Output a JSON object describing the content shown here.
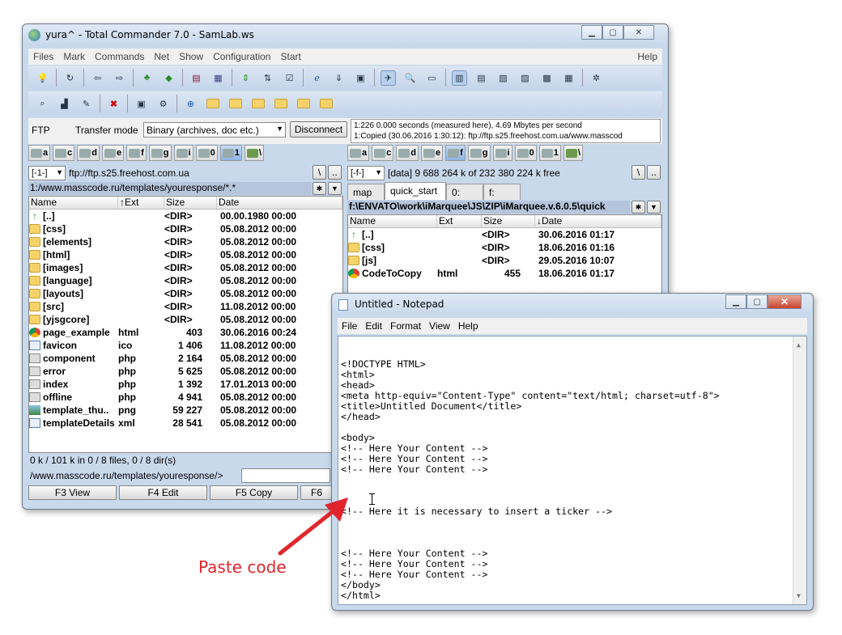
{
  "tc": {
    "title": "yura^ - Total Commander 7.0 - SamLab.ws",
    "menu": [
      "Files",
      "Mark",
      "Commands",
      "Net",
      "Show",
      "Configuration",
      "Start"
    ],
    "menu_help": "Help",
    "ftp_label": "FTP",
    "transfer_label": "Transfer mode",
    "transfer_mode": "Binary (archives, doc etc.)",
    "disconnect_label": "Disconnect",
    "log": [
      "1:226 0.000 seconds (measured here), 4.69 Mbytes per second",
      "1:Copied (30.06.2016 1:30:12): ftp://ftp.s25.freehost.com.ua/www.masscod"
    ],
    "drives": [
      "a",
      "c",
      "d",
      "e",
      "f",
      "g",
      "i",
      "0",
      "1",
      "\\"
    ],
    "left": {
      "drive_combo": "[-1-]",
      "location": "ftp://ftp.s25.freehost.com.ua",
      "path": "1:/www.masscode.ru/templates/youresponse/*.*",
      "columns": [
        "Name",
        "↑Ext",
        "Size",
        "Date"
      ],
      "files": [
        {
          "icon": "up",
          "name": "[..]",
          "ext": "",
          "size": "<DIR>",
          "date": "00.00.1980 00:00"
        },
        {
          "icon": "folder",
          "name": "[css]",
          "ext": "",
          "size": "<DIR>",
          "date": "05.08.2012 00:00"
        },
        {
          "icon": "folder",
          "name": "[elements]",
          "ext": "",
          "size": "<DIR>",
          "date": "05.08.2012 00:00"
        },
        {
          "icon": "folder",
          "name": "[html]",
          "ext": "",
          "size": "<DIR>",
          "date": "05.08.2012 00:00"
        },
        {
          "icon": "folder",
          "name": "[images]",
          "ext": "",
          "size": "<DIR>",
          "date": "05.08.2012 00:00"
        },
        {
          "icon": "folder",
          "name": "[language]",
          "ext": "",
          "size": "<DIR>",
          "date": "05.08.2012 00:00"
        },
        {
          "icon": "folder",
          "name": "[layouts]",
          "ext": "",
          "size": "<DIR>",
          "date": "05.08.2012 00:00"
        },
        {
          "icon": "folder",
          "name": "[src]",
          "ext": "",
          "size": "<DIR>",
          "date": "11.08.2012 00:00"
        },
        {
          "icon": "folder",
          "name": "[yjsgcore]",
          "ext": "",
          "size": "<DIR>",
          "date": "05.08.2012 00:00"
        },
        {
          "icon": "chrome",
          "name": "page_example",
          "ext": "html",
          "size": "403",
          "date": "30.06.2016 00:24"
        },
        {
          "icon": "doc",
          "name": "favicon",
          "ext": "ico",
          "size": "1 406",
          "date": "11.08.2012 00:00"
        },
        {
          "icon": "dll",
          "name": "component",
          "ext": "php",
          "size": "2 164",
          "date": "05.08.2012 00:00"
        },
        {
          "icon": "dll",
          "name": "error",
          "ext": "php",
          "size": "5 625",
          "date": "05.08.2012 00:00"
        },
        {
          "icon": "dll",
          "name": "index",
          "ext": "php",
          "size": "1 392",
          "date": "17.01.2013 00:00"
        },
        {
          "icon": "dll",
          "name": "offline",
          "ext": "php",
          "size": "4 941",
          "date": "05.08.2012 00:00"
        },
        {
          "icon": "img",
          "name": "template_thu..",
          "ext": "png",
          "size": "59 227",
          "date": "05.08.2012 00:00"
        },
        {
          "icon": "doc",
          "name": "templateDetails",
          "ext": "xml",
          "size": "28 541",
          "date": "05.08.2012 00:00"
        }
      ],
      "status": "0 k / 101 k in 0 / 8 files, 0 / 8 dir(s)",
      "cmd_path": "/www.masscode.ru/templates/youresponse/>"
    },
    "right": {
      "drive_combo": "[-f-]",
      "location": "[data]  9 688 264 k of 232 380 224 k free",
      "tabs": [
        "map",
        "quick_start",
        "0:",
        "f:"
      ],
      "path": "f:\\ENVATO\\work\\iMarquee\\JS\\ZIP\\iMarquee.v.6.0.5\\quick",
      "columns": [
        "Name",
        "Ext",
        "Size",
        "↓Date"
      ],
      "files": [
        {
          "icon": "up",
          "name": "[..]",
          "ext": "",
          "size": "<DIR>",
          "date": "30.06.2016 01:17"
        },
        {
          "icon": "folder",
          "name": "[css]",
          "ext": "",
          "size": "<DIR>",
          "date": "18.06.2016 01:16"
        },
        {
          "icon": "folder",
          "name": "[js]",
          "ext": "",
          "size": "<DIR>",
          "date": "29.05.2016 10:07"
        },
        {
          "icon": "chrome",
          "name": "CodeToCopy",
          "ext": "html",
          "size": "455",
          "date": "18.06.2016 01:17"
        }
      ]
    },
    "fkeys": [
      "F3 View",
      "F4 Edit",
      "F5 Copy",
      "F6"
    ]
  },
  "notepad": {
    "title": "Untitled - Notepad",
    "menu": [
      "File",
      "Edit",
      "Format",
      "View",
      "Help"
    ],
    "content": "<!DOCTYPE HTML>\n<html>\n<head>\n<meta http-equiv=\"Content-Type\" content=\"text/html; charset=utf-8\">\n<title>Untitled Document</title>\n</head>\n\n<body>\n<!-- Here Your Content -->\n<!-- Here Your Content -->\n<!-- Here Your Content -->\n\n\n\n<!-- Here it is necessary to insert a ticker -->\n\n\n\n<!-- Here Your Content -->\n<!-- Here Your Content -->\n<!-- Here Your Content -->\n</body>\n</html>"
  },
  "annotation": {
    "label": "Paste code",
    "color": "#e0262c"
  }
}
